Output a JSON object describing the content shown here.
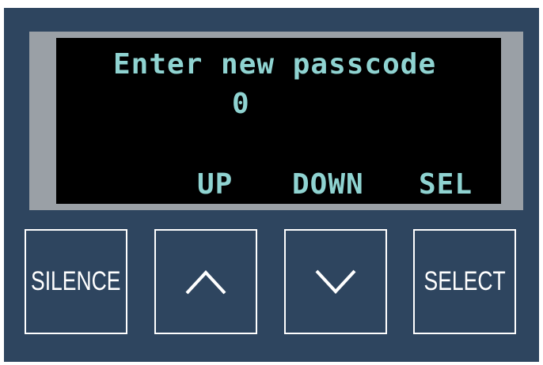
{
  "display": {
    "prompt": "Enter new passcode",
    "digit": "0",
    "softkeys": {
      "up": "UP",
      "down": "DOWN",
      "sel": "SEL"
    }
  },
  "buttons": {
    "silence_label": "SILENCE",
    "up_icon": "chevron-up-icon",
    "down_icon": "chevron-down-icon",
    "select_label": "SELECT"
  },
  "colors": {
    "panel": "#2e455f",
    "bezel": "#9aa0a6",
    "screen": "#000000",
    "lcd_text": "#8fd3d1",
    "button_border": "#ffffff"
  }
}
